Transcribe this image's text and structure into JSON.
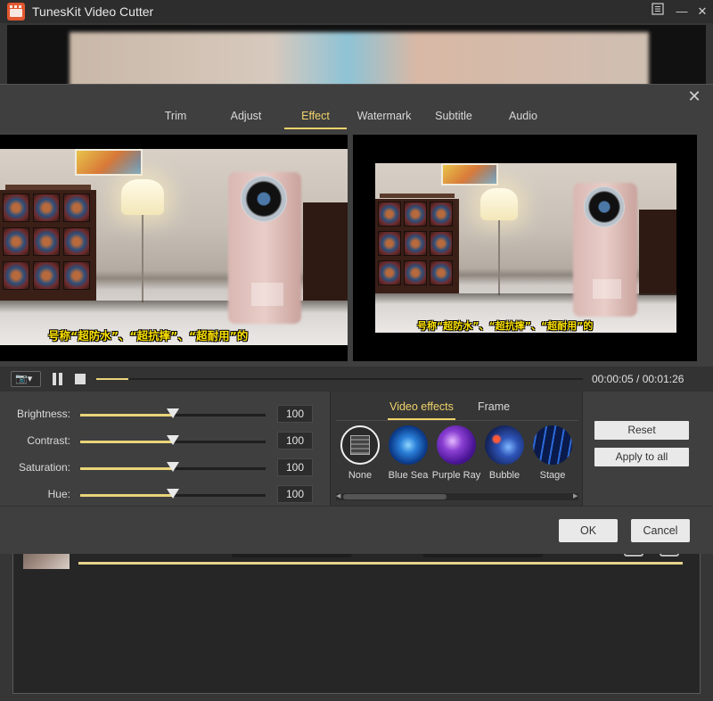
{
  "window": {
    "title": "TunesKit Video Cutter",
    "menu_icon": "list-icon",
    "minimize_glyph": "—",
    "close_glyph": "✕"
  },
  "dialog": {
    "close_glyph": "✕",
    "tabs": [
      {
        "label": "Trim",
        "active": false
      },
      {
        "label": "Adjust",
        "active": false
      },
      {
        "label": "Effect",
        "active": true
      },
      {
        "label": "Watermark",
        "active": false
      },
      {
        "label": "Subtitle",
        "active": false
      },
      {
        "label": "Audio",
        "active": false
      }
    ],
    "preview": {
      "subtitle_text": "号称“超防水”、“超抗摔”、“超耐用”的"
    },
    "playback": {
      "camera_glyph": "📷▾",
      "progress": 0.066,
      "time_display": "00:00:05 / 00:01:26"
    },
    "adjust": {
      "sliders": [
        {
          "label": "Brightness:",
          "value": "100",
          "level": 0.5
        },
        {
          "label": "Contrast:",
          "value": "100",
          "level": 0.5
        },
        {
          "label": "Saturation:",
          "value": "100",
          "level": 0.5
        },
        {
          "label": "Hue:",
          "value": "100",
          "level": 0.5
        }
      ]
    },
    "effects": {
      "tabs": [
        {
          "label": "Video effects",
          "active": true
        },
        {
          "label": "Frame",
          "active": false
        }
      ],
      "items": [
        {
          "label": "None",
          "icon": "none-effect-icon",
          "selected": true
        },
        {
          "label": "Blue Sea",
          "icon": "blue-sea-effect-icon",
          "selected": false
        },
        {
          "label": "Purple Ray",
          "icon": "purple-ray-effect-icon",
          "selected": false
        },
        {
          "label": "Bubble",
          "icon": "bubble-effect-icon",
          "selected": false
        },
        {
          "label": "Stage",
          "icon": "stage-effect-icon",
          "selected": false
        }
      ]
    },
    "side_buttons": {
      "reset": "Reset",
      "apply_all": "Apply to all"
    },
    "footer": {
      "ok": "OK",
      "cancel": "Cancel"
    }
  },
  "colors": {
    "accent": "#f0d36b",
    "background": "#3f3f3f",
    "subtitle": "#ffe400"
  }
}
